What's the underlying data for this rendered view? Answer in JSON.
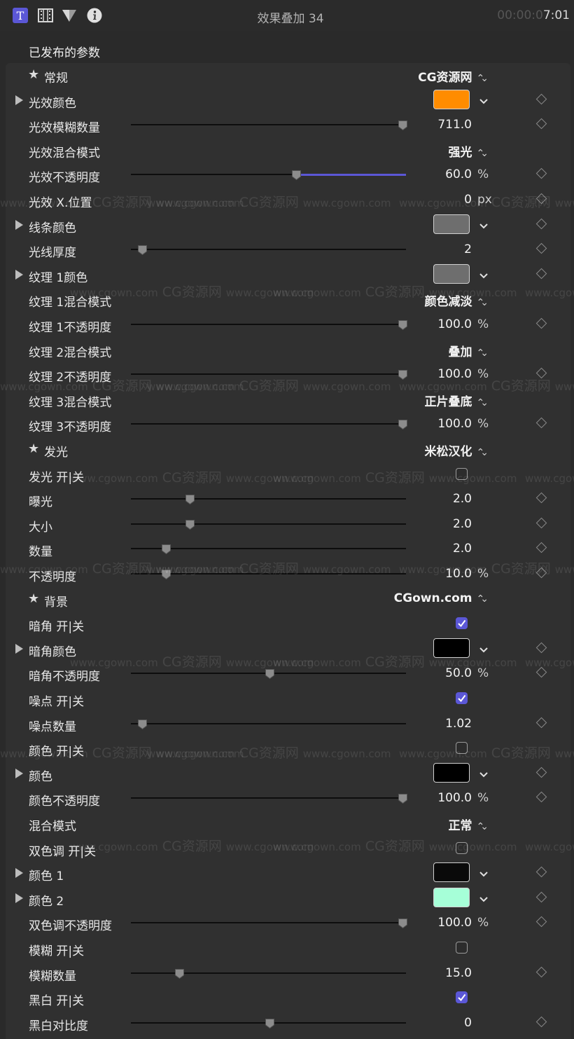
{
  "title": "效果叠加 34",
  "timecode": {
    "dim": "00:00:0",
    "bright": "7:01"
  },
  "section": "已发布的参数",
  "unit_percent": "%",
  "unit_px": "px",
  "watermark": {
    "url": "www.cgown.com",
    "name": "CG资源网"
  },
  "rows": [
    {
      "type": "group",
      "label": "常规",
      "value": "CG资源网"
    },
    {
      "type": "color",
      "label": "光效颜色",
      "color": "#ff8c00"
    },
    {
      "type": "slider",
      "label": "光效模糊数量",
      "value": "711.0",
      "pos": 1.0
    },
    {
      "type": "popup",
      "label": "光效混合模式",
      "value": "强光"
    },
    {
      "type": "slider",
      "label": "光效不透明度",
      "value": "60.0",
      "unit": "%",
      "pos": 0.6,
      "active": true
    },
    {
      "type": "value",
      "label": "光效 X.位置",
      "value": "0",
      "unit": "px"
    },
    {
      "type": "color",
      "label": "线条颜色",
      "color": "#6e6e6e"
    },
    {
      "type": "slider",
      "label": "光线厚度",
      "value": "2",
      "pos": 0.02
    },
    {
      "type": "color",
      "label": "纹理 1颜色",
      "color": "#6e6e6e"
    },
    {
      "type": "popup",
      "label": "纹理 1混合模式",
      "value": "颜色减淡"
    },
    {
      "type": "slider",
      "label": "纹理 1不透明度",
      "value": "100.0",
      "unit": "%",
      "pos": 1.0
    },
    {
      "type": "popup",
      "label": "纹理 2混合模式",
      "value": "叠加"
    },
    {
      "type": "slider",
      "label": "纹理 2不透明度",
      "value": "100.0",
      "unit": "%",
      "pos": 1.0
    },
    {
      "type": "popup",
      "label": "纹理 3混合模式",
      "value": "正片叠底"
    },
    {
      "type": "slider",
      "label": "纹理 3不透明度",
      "value": "100.0",
      "unit": "%",
      "pos": 1.0
    },
    {
      "type": "group",
      "label": "发光",
      "value": "米松汉化"
    },
    {
      "type": "check",
      "label": "发光 开|关",
      "checked": false
    },
    {
      "type": "slider",
      "label": "曝光",
      "value": "2.0",
      "pos": 0.2
    },
    {
      "type": "slider",
      "label": "大小",
      "value": "2.0",
      "pos": 0.2
    },
    {
      "type": "slider",
      "label": "数量",
      "value": "2.0",
      "pos": 0.11
    },
    {
      "type": "slider",
      "label": "不透明度",
      "value": "10.0",
      "unit": "%",
      "pos": 0.11
    },
    {
      "type": "group",
      "label": "背景",
      "value": "CGown.com"
    },
    {
      "type": "check",
      "label": "暗角 开|关",
      "checked": true
    },
    {
      "type": "color",
      "label": "暗角颜色",
      "color": "#000000"
    },
    {
      "type": "slider",
      "label": "暗角不透明度",
      "value": "50.0",
      "unit": "%",
      "pos": 0.5
    },
    {
      "type": "check",
      "label": "噪点 开|关",
      "checked": true
    },
    {
      "type": "slider",
      "label": "噪点数量",
      "value": "1.02",
      "pos": 0.02
    },
    {
      "type": "check",
      "label": "颜色 开|关",
      "checked": false
    },
    {
      "type": "color",
      "label": "颜色",
      "color": "#000000"
    },
    {
      "type": "slider",
      "label": "颜色不透明度",
      "value": "100.0",
      "unit": "%",
      "pos": 1.0
    },
    {
      "type": "popup",
      "label": "混合模式",
      "value": "正常"
    },
    {
      "type": "check",
      "label": "双色调 开|关",
      "checked": false
    },
    {
      "type": "color",
      "label": "颜色 1",
      "color": "#0a0a0a"
    },
    {
      "type": "color",
      "label": "颜色 2",
      "color": "#a6ffd8"
    },
    {
      "type": "slider",
      "label": "双色调不透明度",
      "value": "100.0",
      "unit": "%",
      "pos": 1.0
    },
    {
      "type": "check",
      "label": "模糊 开|关",
      "checked": false
    },
    {
      "type": "slider",
      "label": "模糊数量",
      "value": "15.0",
      "pos": 0.16
    },
    {
      "type": "check",
      "label": "黑白 开|关",
      "checked": true
    },
    {
      "type": "slider",
      "label": "黑白对比度",
      "value": "0",
      "pos": 0.5
    }
  ]
}
